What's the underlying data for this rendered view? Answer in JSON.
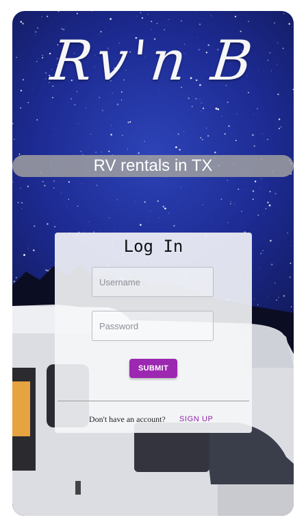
{
  "brand": {
    "logo_text": "Rv'n B",
    "tagline": "RV rentals in TX"
  },
  "login": {
    "title": "Log In",
    "username_placeholder": "Username",
    "password_placeholder": "Password",
    "submit_label": "SUBMIT",
    "account_prompt": "Don't have an account?",
    "signup_label": "SIGN UP"
  },
  "colors": {
    "accent": "#9c27b0",
    "tagline_bg": "#a0a0a0",
    "sky": "#1d2b93"
  }
}
